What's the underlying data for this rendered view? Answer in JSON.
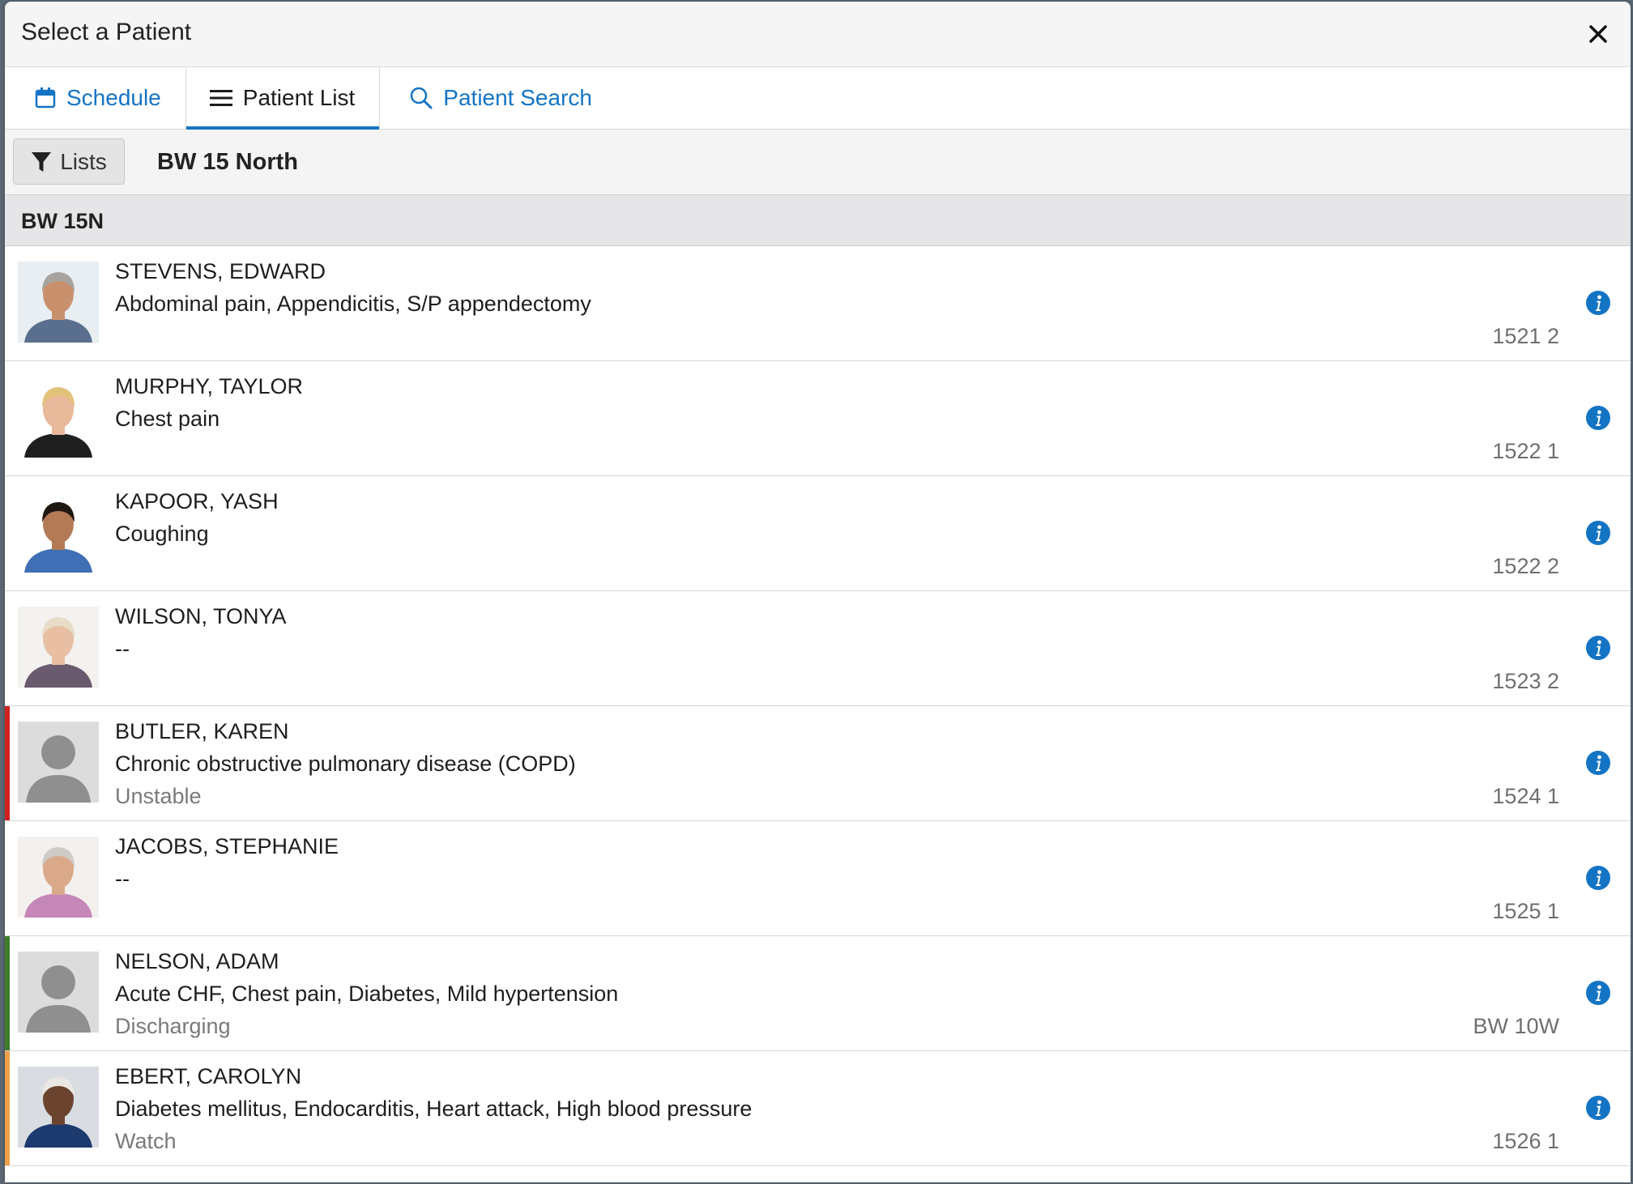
{
  "dialog": {
    "title": "Select a Patient"
  },
  "tabs": [
    {
      "label": "Schedule",
      "icon": "calendar-icon",
      "active": false
    },
    {
      "label": "Patient List",
      "icon": "hamburger-list-icon",
      "active": true
    },
    {
      "label": "Patient Search",
      "icon": "search-icon",
      "active": false
    }
  ],
  "toolbar": {
    "lists_label": "Lists",
    "current_list": "BW 15 North"
  },
  "group": {
    "title": "BW 15N"
  },
  "patients": [
    {
      "name": "STEVENS, EDWARD",
      "diagnosis": "Abdominal pain, Appendicitis, S/P appendectomy",
      "status": "",
      "room": "1521 2",
      "photo": "photo",
      "status_color": ""
    },
    {
      "name": "MURPHY, TAYLOR",
      "diagnosis": "Chest pain",
      "status": "",
      "room": "1522 1",
      "photo": "photo",
      "status_color": ""
    },
    {
      "name": "KAPOOR, YASH",
      "diagnosis": "Coughing",
      "status": "",
      "room": "1522 2",
      "photo": "photo",
      "status_color": ""
    },
    {
      "name": "WILSON, TONYA",
      "diagnosis": "--",
      "status": "",
      "room": "1523 2",
      "photo": "photo",
      "status_color": ""
    },
    {
      "name": "BUTLER, KAREN",
      "diagnosis": "Chronic obstructive pulmonary disease (COPD)",
      "status": "Unstable",
      "room": "1524 1",
      "photo": "placeholder",
      "status_color": "#d0201f"
    },
    {
      "name": "JACOBS, STEPHANIE",
      "diagnosis": "--",
      "status": "",
      "room": "1525 1",
      "photo": "photo",
      "status_color": ""
    },
    {
      "name": "NELSON, ADAM",
      "diagnosis": "Acute CHF, Chest pain, Diabetes, Mild hypertension",
      "status": "Discharging",
      "room": "BW 10W",
      "photo": "placeholder",
      "status_color": "#3f7d2a"
    },
    {
      "name": "EBERT, CAROLYN",
      "diagnosis": "Diabetes mellitus, Endocarditis, Heart attack, High blood pressure",
      "status": "Watch",
      "room": "1526 1",
      "photo": "photo",
      "status_color": "#f0a046"
    }
  ],
  "colors": {
    "accent": "#1474c4",
    "unstable": "#d0201f",
    "discharging": "#3f7d2a",
    "watch": "#f0a046"
  }
}
